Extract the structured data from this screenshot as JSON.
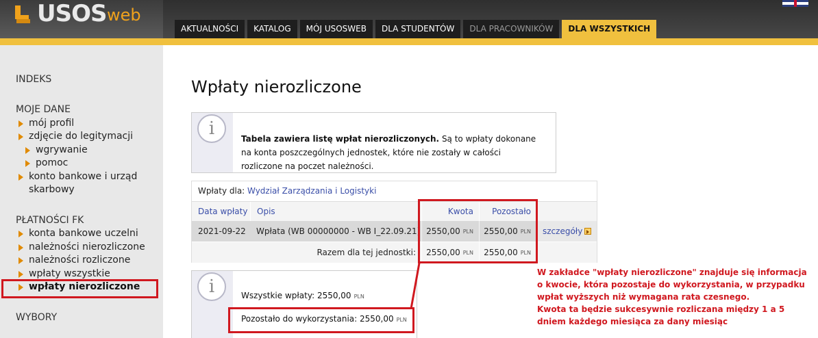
{
  "app": {
    "logo_main": "USOS",
    "logo_sub": "web"
  },
  "nav": {
    "tabs": [
      {
        "label": "AKTUALNOŚCI"
      },
      {
        "label": "KATALOG"
      },
      {
        "label": "MÓJ USOSWEB"
      },
      {
        "label": "DLA STUDENTÓW"
      },
      {
        "label": "DLA PRACOWNIKÓW"
      },
      {
        "label": "DLA WSZYSTKICH"
      }
    ]
  },
  "sidebar": {
    "sections": [
      {
        "heading": "INDEKS"
      },
      {
        "heading": "MOJE DANE",
        "items": [
          {
            "label": "mój profil"
          },
          {
            "label": "zdjęcie do legitymacji"
          },
          {
            "label": "wgrywanie"
          },
          {
            "label": "pomoc"
          },
          {
            "label": "konto bankowe i urząd skarbowy"
          }
        ]
      },
      {
        "heading": "PŁATNOŚCI FK",
        "items": [
          {
            "label": "konta bankowe uczelni"
          },
          {
            "label": "należności nierozliczone"
          },
          {
            "label": "należności rozliczone"
          },
          {
            "label": "wpłaty wszystkie"
          },
          {
            "label": "wpłaty nierozliczone"
          }
        ]
      },
      {
        "heading": "WYBORY"
      }
    ]
  },
  "main": {
    "title": "Wpłaty nierozliczone",
    "info": {
      "bold": "Tabela zawiera listę wpłat nierozliczonych.",
      "rest": " Są to wpłaty dokonane na konta poszczególnych jednostek, które nie zostały w całości rozliczone na poczet należności."
    },
    "table": {
      "for_label": "Wpłaty dla: ",
      "for_unit": "Wydział Zarządzania i Logistyki",
      "headers": {
        "date": "Data wpłaty",
        "desc": "Opis",
        "amount": "Kwota",
        "remaining": "Pozostało"
      },
      "rows": [
        {
          "date": "2021-09-22",
          "desc": "Wpłata (WB 00000000 - WB I_22.09.21)",
          "amount": "2550,00",
          "remaining": "2550,00",
          "details": "szczegóły"
        }
      ],
      "total_label": "Razem dla tej jednostki:",
      "total_amount": "2550,00",
      "total_remaining": "2550,00",
      "currency": "PLN"
    },
    "summary": {
      "all_label": "Wszystkie wpłaty: 2550,00",
      "left_label": "Pozostało do wykorzystania: 2550,00",
      "currency": "PLN"
    },
    "annotation": [
      "W zakładce \"wpłaty nierozliczone\" znajduje się informacja",
      "o kwocie, która pozostaje do wykorzystania, w przypadku",
      "wpłat wyższych niż wymagana rata czesnego.",
      "Kwota ta będzie sukcesywnie rozliczana między 1 a 5",
      "dniem każdego miesiąca za dany miesiąc"
    ],
    "colors": {
      "accent": "#f0c03e",
      "annotation_red": "#d0181f",
      "link": "#3a4ea8"
    }
  }
}
